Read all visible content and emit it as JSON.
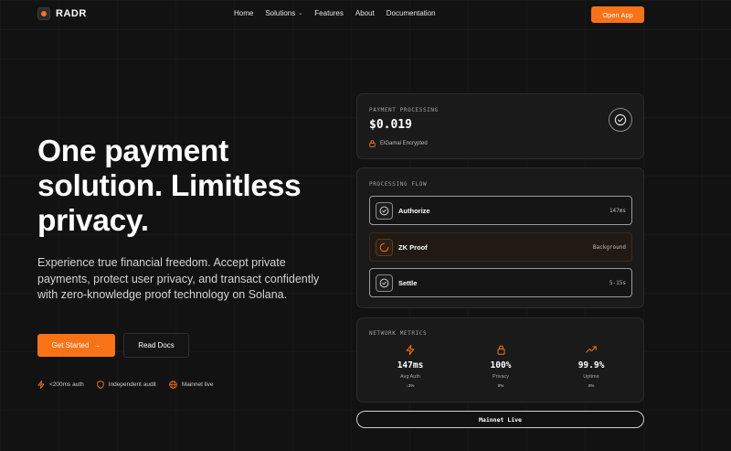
{
  "nav": {
    "brand": "RADR",
    "links": [
      "Home",
      "Solutions",
      "Features",
      "About",
      "Documentation"
    ],
    "cta": "Open App"
  },
  "hero": {
    "title_line1": "One payment",
    "title_line2": "solution. Limitless",
    "title_line3": "privacy.",
    "subtitle": "Experience true financial freedom. Accept private payments, protect user privacy, and transact confidently with zero-knowledge proof technology on Solana.",
    "primary_button": "Get Started",
    "secondary_button": "Read Docs",
    "features": [
      "<200ms auth",
      "Independent audit",
      "Mainnet live"
    ]
  },
  "payment_card": {
    "label": "PAYMENT PROCESSING",
    "amount": "$0.019",
    "encryption": "ElGamal Encrypted"
  },
  "flow_card": {
    "label": "PROCESSING FLOW",
    "steps": [
      {
        "name": "Authorize",
        "time": "147ms"
      },
      {
        "name": "ZK Proof",
        "time": "Background"
      },
      {
        "name": "Settle",
        "time": "5-15s"
      }
    ]
  },
  "metrics_card": {
    "label": "NETWORK METRICS",
    "metrics": [
      {
        "value": "147ms",
        "label": "Avg Auth",
        "delta": "↓3%"
      },
      {
        "value": "100%",
        "label": "Privacy",
        "delta": "0%"
      },
      {
        "value": "99.9%",
        "label": "Uptime",
        "delta": "0%"
      }
    ]
  },
  "status_pill": "Mainnet Live",
  "colors": {
    "accent": "#f97316",
    "background": "#121212",
    "card": "#1a1a1a"
  }
}
